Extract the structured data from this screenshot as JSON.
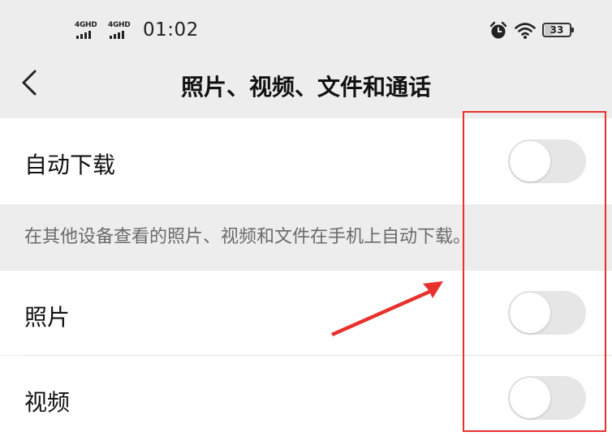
{
  "status_bar": {
    "signal_1": "4GHD",
    "signal_2": "4GHD",
    "time": "01:02",
    "battery": "33",
    "battery_level": 0.33,
    "icons": [
      "alarm-icon",
      "wifi-icon",
      "battery-icon"
    ]
  },
  "nav": {
    "back_icon": "chevron-left-icon",
    "title": "照片、视频、文件和通话"
  },
  "settings": {
    "auto_download": {
      "label": "自动下载",
      "enabled": false
    },
    "hint": "在其他设备查看的照片、视频和文件在手机上自动下载。",
    "photos": {
      "label": "照片",
      "enabled": false
    },
    "videos": {
      "label": "视频",
      "enabled": false
    }
  },
  "colors": {
    "background": "#ededed",
    "row": "#ffffff",
    "toggle_off": "#e6e6e6",
    "annotation": "#e8312c"
  }
}
